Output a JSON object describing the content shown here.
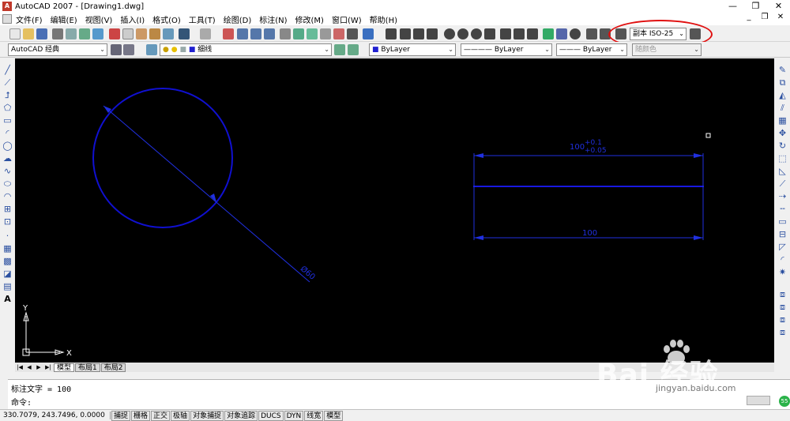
{
  "window": {
    "title": "AutoCAD 2007 - [Drawing1.dwg]",
    "app_icon": "A",
    "controls": [
      "—",
      "❐",
      "✕"
    ]
  },
  "menu": {
    "items": [
      "文件(F)",
      "编辑(E)",
      "视图(V)",
      "插入(I)",
      "格式(O)",
      "工具(T)",
      "绘图(D)",
      "标注(N)",
      "修改(M)",
      "窗口(W)",
      "帮助(H)"
    ],
    "mdi_controls": [
      "_",
      "❐",
      "✕"
    ]
  },
  "toolbar2": {
    "workspace": "AutoCAD 经典",
    "layer": "细线",
    "color": "ByLayer",
    "linetype": "ByLayer",
    "lineweight": "ByLayer",
    "plotstyle": "随颜色"
  },
  "toolbar1": {
    "dim_style": "副本 ISO-25"
  },
  "canvas": {
    "circle_dim": "Ø60",
    "top_dim_text": "100",
    "tol_upper": "+0.1",
    "tol_lower": "+0.05",
    "bottom_dim_text": "100",
    "ucs_y": "Y",
    "ucs_x": "X"
  },
  "tabs": {
    "items": [
      "模型",
      "布局1",
      "布局2"
    ],
    "nav": [
      "|◀",
      "◀",
      "▶",
      "▶|"
    ]
  },
  "command": {
    "history": "标注文字 = 100",
    "prompt": "命令:"
  },
  "status": {
    "coords": "330.7079, 243.7496, 0.0000",
    "toggles": [
      "捕捉",
      "栅格",
      "正交",
      "极轴",
      "对象捕捉",
      "对象追踪",
      "DUCS",
      "DYN",
      "线宽",
      "模型"
    ]
  },
  "watermark": {
    "logo": "Bai  经验",
    "url": "jingyan.baidu.com"
  },
  "badge": "55",
  "colors": {
    "canvas_bg": "#000000",
    "geometry": "#1010d0",
    "dimension": "#2030e0",
    "highlight": "#e01010"
  }
}
